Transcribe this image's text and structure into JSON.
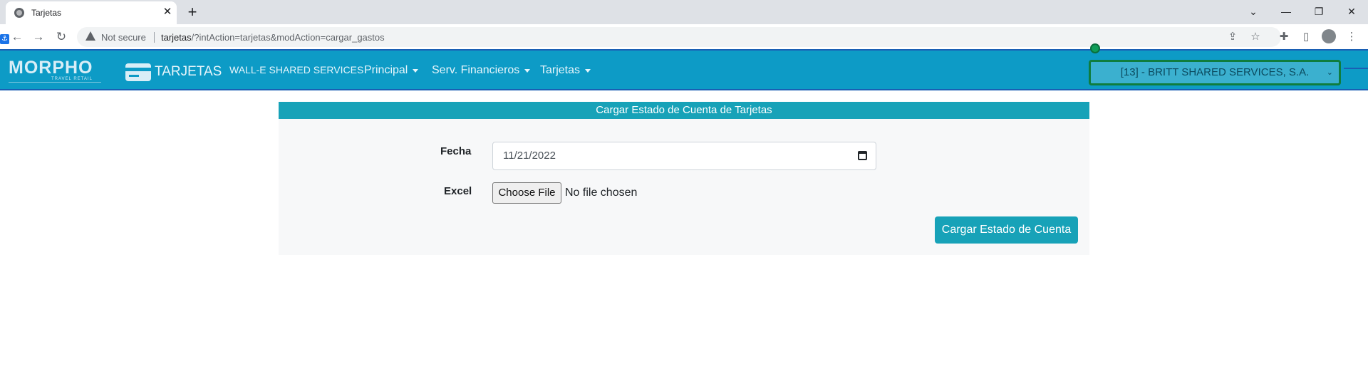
{
  "browser": {
    "tab_title": "Tarjetas",
    "tab_close": "✕",
    "new_tab": "+",
    "security_label": "Not secure",
    "url_host": "tarjetas",
    "url_rest": "/?intAction=tarjetas&modAction=cargar_gastos",
    "window_controls": {
      "tabsearch": "⌄",
      "minimize": "—",
      "restore": "❐",
      "close": "✕"
    },
    "nav": {
      "back": "←",
      "forward": "→",
      "reload": "↻"
    },
    "toolbar_icons": {
      "share": "⇪",
      "bookmark": "☆",
      "extensions": "✚",
      "sidepanel": "▯",
      "menu": "⋮"
    }
  },
  "navbar": {
    "logo_text": "MORPHO",
    "logo_subtext": "TRAVEL RETAIL",
    "brand": "TARJETAS",
    "company": "WALL-E SHARED SERVICES",
    "menu": [
      {
        "label": "Principal"
      },
      {
        "label": "Serv. Financieros"
      },
      {
        "label": "Tarjetas"
      }
    ],
    "company_select": {
      "value": "[13] - BRITT SHARED SERVICES, S.A.",
      "chevron": "⌄"
    }
  },
  "form": {
    "title": "Cargar Estado de Cuenta de Tarjetas",
    "date_label": "Fecha",
    "date_value": "11/21/2022",
    "excel_label": "Excel",
    "file_button": "Choose File",
    "file_status": "No file chosen",
    "submit_label": "Cargar Estado de Cuenta"
  },
  "colors": {
    "navbar_bg": "#0d9bc6",
    "card_header_bg": "#17a2b8",
    "submit_bg": "#17a2b8",
    "select_border": "#0f7d3d"
  }
}
